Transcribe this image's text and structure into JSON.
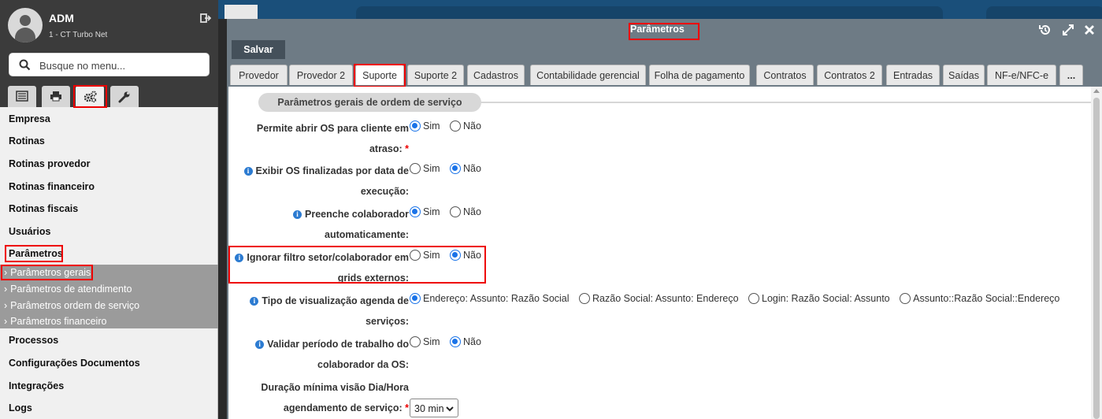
{
  "user": {
    "name": "ADM",
    "company": "1 - CT Turbo Net"
  },
  "search": {
    "placeholder": "Busque no menu..."
  },
  "menu": {
    "items": [
      "Empresa",
      "Rotinas",
      "Rotinas provedor",
      "Rotinas financeiro",
      "Rotinas fiscais",
      "Usuários",
      "Parâmetros"
    ],
    "subitems": [
      "Parâmetros gerais",
      "Parâmetros de atendimento",
      "Parâmetros ordem de serviço",
      "Parâmetros financeiro"
    ],
    "items_after": [
      "Processos",
      "Configurações Documentos",
      "Integrações",
      "Logs"
    ]
  },
  "window": {
    "title": "Parâmetros",
    "save_label": "Salvar"
  },
  "tabs": [
    "Provedor",
    "Provedor 2",
    "Suporte",
    "Suporte 2",
    "Cadastros",
    "Contabilidade gerencial",
    "Folha de pagamento",
    "Contratos",
    "Contratos 2",
    "Entradas",
    "Saídas",
    "NF-e/NFC-e",
    "..."
  ],
  "active_tab": "Suporte",
  "section_title": "Parâmetros gerais de ordem de serviço",
  "fields": [
    {
      "label_1": "Permite abrir OS para cliente em",
      "label_2": "atraso:",
      "required": "*",
      "options": [
        "Sim",
        "Não"
      ],
      "selected": "Sim"
    },
    {
      "label_1": "Exibir OS finalizadas por data de",
      "label_2": "execução:",
      "options": [
        "Sim",
        "Não"
      ],
      "selected": "Não"
    },
    {
      "label_1": "Preenche colaborador",
      "label_2": "automaticamente:",
      "options": [
        "Sim",
        "Não"
      ],
      "selected": "Sim"
    },
    {
      "label_1": "Ignorar filtro setor/colaborador em",
      "label_2": "grids externos:",
      "options": [
        "Sim",
        "Não"
      ],
      "selected": "Não"
    },
    {
      "label_1": "Tipo de visualização agenda de",
      "label_2": "serviços:",
      "options": [
        "Endereço: Assunto: Razão Social",
        "Razão Social: Assunto: Endereço",
        "Login: Razão Social: Assunto",
        "Assunto::Razão Social::Endereço"
      ],
      "selected": "Endereço: Assunto: Razão Social"
    },
    {
      "label_1": "Validar período de trabalho do",
      "label_2": "colaborador da OS:",
      "options": [
        "Sim",
        "Não"
      ],
      "selected": "Não"
    },
    {
      "label_1": "Duração mínima visão Dia/Hora",
      "label_2": "agendamento de serviço:",
      "required": "*",
      "select_value": "30 min"
    }
  ],
  "colors": {
    "accent": "#1a73e8",
    "highlight": "#e00000",
    "sidebar_dark": "#3b3b3b",
    "window_header": "#6e7b85"
  }
}
